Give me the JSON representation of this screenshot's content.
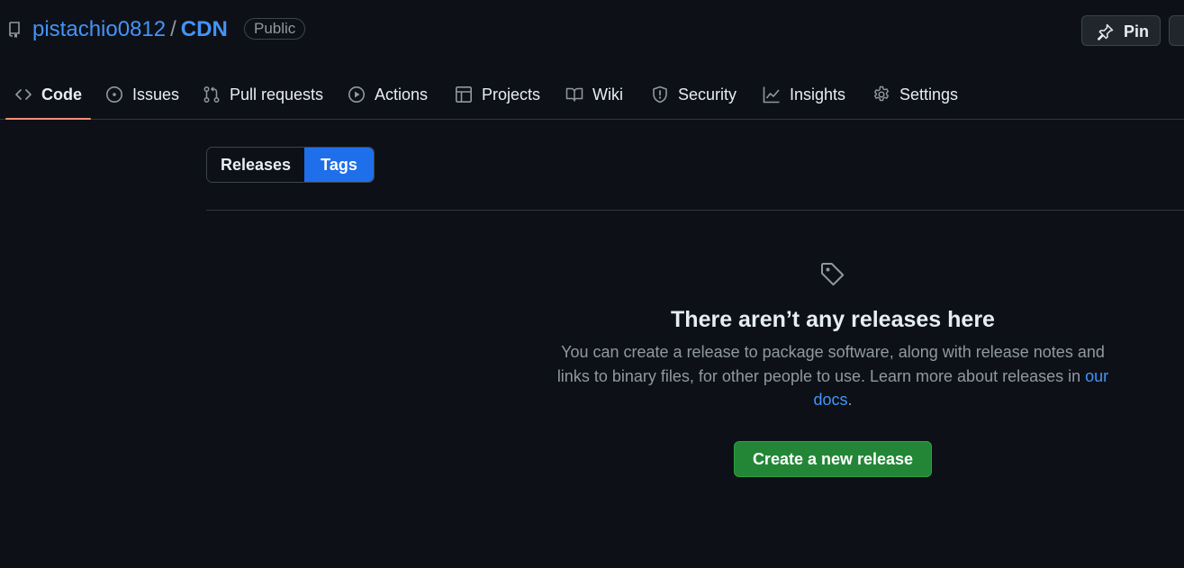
{
  "repo": {
    "owner": "pistachio0812",
    "separator": "/",
    "name": "CDN",
    "visibility": "Public"
  },
  "header_actions": {
    "pin_label": "Pin"
  },
  "nav": {
    "items": [
      {
        "label": "Code",
        "icon": "code-icon",
        "active": true
      },
      {
        "label": "Issues",
        "icon": "issue-icon"
      },
      {
        "label": "Pull requests",
        "icon": "pull-request-icon"
      },
      {
        "label": "Actions",
        "icon": "play-icon"
      },
      {
        "label": "Projects",
        "icon": "table-icon"
      },
      {
        "label": "Wiki",
        "icon": "book-icon"
      },
      {
        "label": "Security",
        "icon": "shield-icon"
      },
      {
        "label": "Insights",
        "icon": "graph-icon"
      },
      {
        "label": "Settings",
        "icon": "gear-icon"
      }
    ]
  },
  "toggle": {
    "releases_label": "Releases",
    "tags_label": "Tags",
    "selected": "Tags"
  },
  "blankslate": {
    "icon": "tag-icon",
    "title": "There aren’t any releases here",
    "description": "You can create a release to package software, along with release notes and links to binary files, for other people to use. Learn more about releases in",
    "link_text": "our docs",
    "trailing": ".",
    "button_label": "Create a new release"
  },
  "colors": {
    "background": "#0d1117",
    "link": "#4493f8",
    "active_underline": "#fd8c73",
    "primary_button": "#238636",
    "selected_segment": "#1f6feb"
  }
}
